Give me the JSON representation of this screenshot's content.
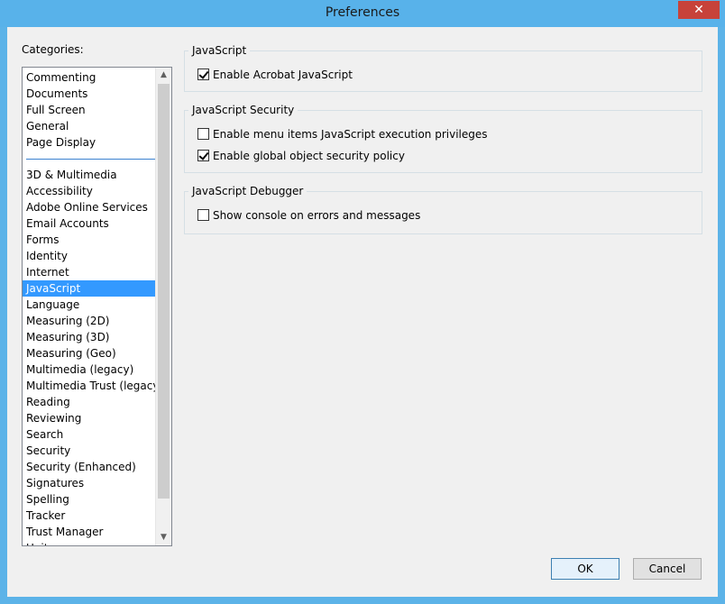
{
  "window": {
    "title": "Preferences",
    "close_glyph": "✕"
  },
  "categories": {
    "label": "Categories:",
    "top_items": [
      "Commenting",
      "Documents",
      "Full Screen",
      "General",
      "Page Display"
    ],
    "items": [
      "3D & Multimedia",
      "Accessibility",
      "Adobe Online Services",
      "Email Accounts",
      "Forms",
      "Identity",
      "Internet",
      "JavaScript",
      "Language",
      "Measuring (2D)",
      "Measuring (3D)",
      "Measuring (Geo)",
      "Multimedia (legacy)",
      "Multimedia Trust (legacy)",
      "Reading",
      "Reviewing",
      "Search",
      "Security",
      "Security (Enhanced)",
      "Signatures",
      "Spelling",
      "Tracker",
      "Trust Manager",
      "Units"
    ],
    "selected": "JavaScript"
  },
  "groups": {
    "javascript": {
      "title": "JavaScript",
      "options": [
        {
          "label": "Enable Acrobat JavaScript",
          "checked": true
        }
      ]
    },
    "security": {
      "title": "JavaScript Security",
      "options": [
        {
          "label": "Enable menu items JavaScript execution privileges",
          "checked": false
        },
        {
          "label": "Enable global object security policy",
          "checked": true
        }
      ]
    },
    "debugger": {
      "title": "JavaScript Debugger",
      "options": [
        {
          "label": "Show console on errors and messages",
          "checked": false
        }
      ]
    }
  },
  "buttons": {
    "ok": "OK",
    "cancel": "Cancel"
  }
}
